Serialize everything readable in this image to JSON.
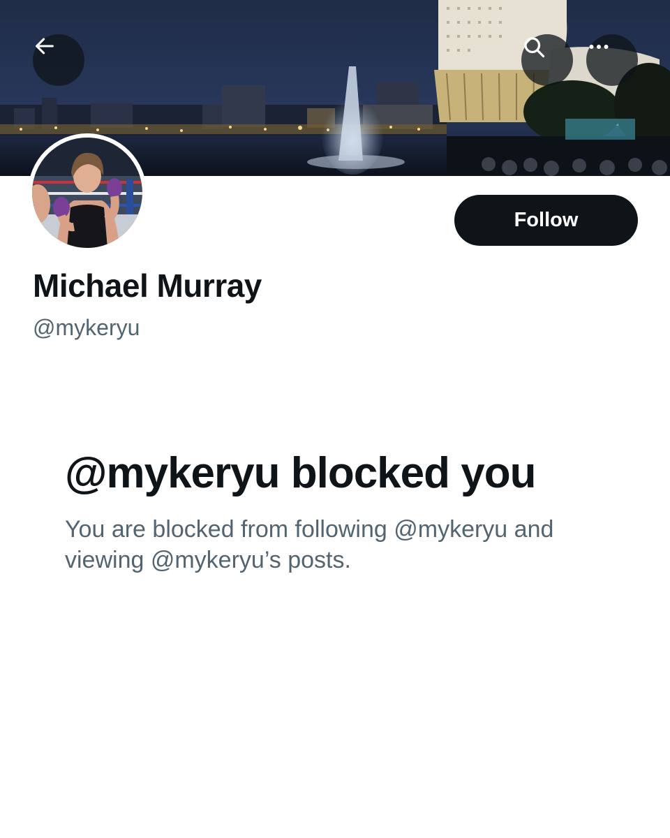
{
  "profile": {
    "display_name": "Michael Murray",
    "handle": "@mykeryu"
  },
  "actions": {
    "follow_label": "Follow"
  },
  "blocked": {
    "title": "@mykeryu blocked you",
    "description": "You are blocked from following @mykeryu and viewing @mykeryu’s posts."
  },
  "icons": {
    "back": "arrow-left-icon",
    "search": "search-icon",
    "more": "more-horizontal-icon"
  },
  "colors": {
    "primary_text": "#0f1419",
    "secondary_text": "#536471",
    "button_bg": "#0f1419",
    "button_text": "#ffffff"
  }
}
